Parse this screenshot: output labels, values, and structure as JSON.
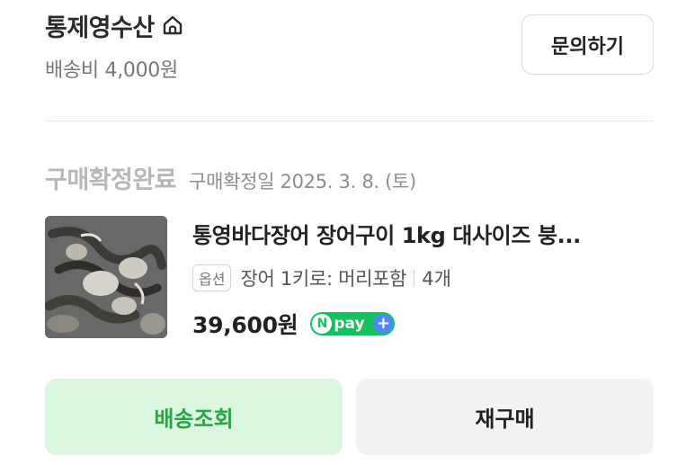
{
  "store": {
    "name": "통제영수산",
    "shipping_fee": "배송비 4,000원",
    "inquiry_label": "문의하기",
    "icon": "home-icon"
  },
  "order": {
    "status": "구매확정완료",
    "confirm_date": "구매확정일 2025. 3. 8. (토)"
  },
  "product": {
    "title": "통영바다장어 장어구이 1kg 대사이즈 붕...",
    "option_badge": "옵션",
    "option_text": "장어 1키로: 머리포함",
    "quantity": "4개",
    "price": "39,600원",
    "npay_label": "pay",
    "npay_n": "N",
    "npay_plus": "+",
    "thumbnail": "grilled-eel-photo"
  },
  "actions": {
    "track_label": "배송조회",
    "rebuy_label": "재구매"
  },
  "colors": {
    "track_bg": "#dcf7df",
    "track_text": "#2aa445",
    "npay_green": "#15c15c",
    "npay_plus_blue": "#4d8bf3"
  }
}
